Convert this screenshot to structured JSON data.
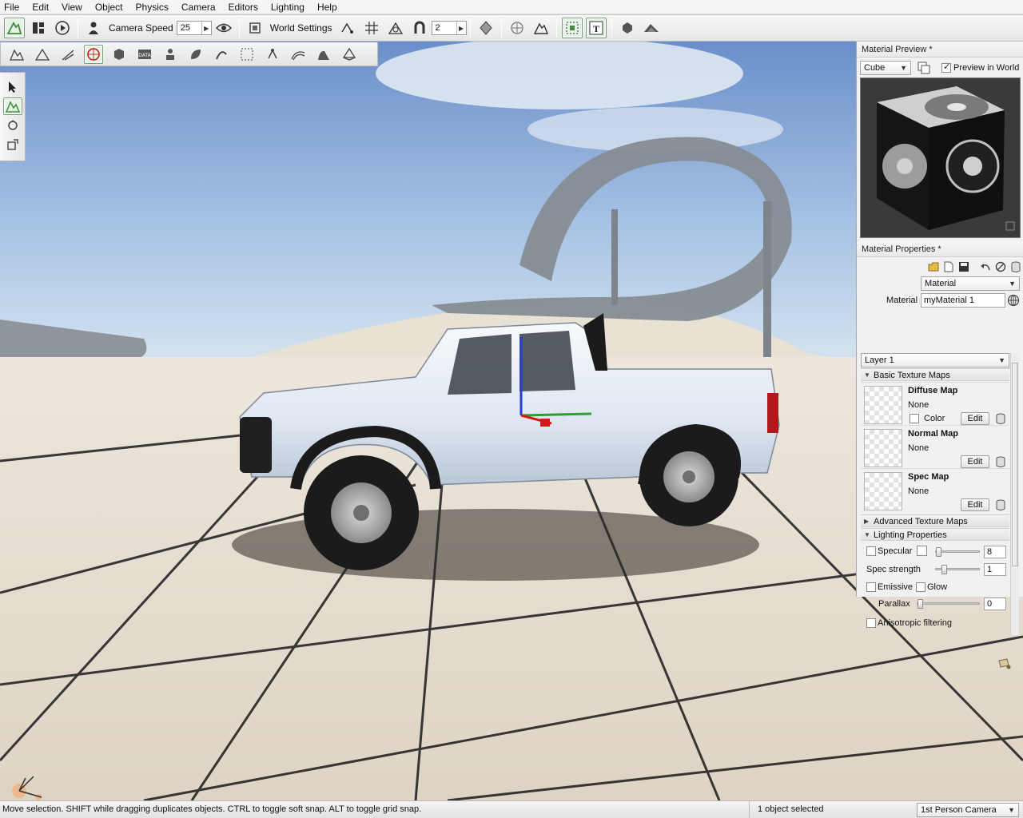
{
  "menu": [
    "File",
    "Edit",
    "View",
    "Object",
    "Physics",
    "Camera",
    "Editors",
    "Lighting",
    "Help"
  ],
  "toolbar": {
    "camera_speed_label": "Camera Speed",
    "camera_speed_value": "25",
    "world_settings_label": "World Settings",
    "snap_value": "2"
  },
  "material_preview": {
    "title": "Material Preview *",
    "shape": "Cube",
    "preview_in_world_label": "Preview in World",
    "preview_in_world_checked": true
  },
  "material_properties": {
    "title": "Material Properties *",
    "type_select": "Material",
    "material_label": "Material",
    "material_name": "myMaterial 1",
    "layer": "Layer 1",
    "basic_texture_maps": "Basic Texture Maps",
    "maps": [
      {
        "name": "Diffuse Map",
        "value": "None",
        "color_label": "Color",
        "edit": "Edit"
      },
      {
        "name": "Normal Map",
        "value": "None",
        "edit": "Edit"
      },
      {
        "name": "Spec Map",
        "value": "None",
        "edit": "Edit"
      }
    ],
    "advanced_texture_maps": "Advanced Texture Maps",
    "lighting_properties": "Lighting Properties",
    "specular_label": "Specular",
    "specular_value": "8",
    "spec_strength_label": "Spec strength",
    "spec_strength_value": "1",
    "emissive_label": "Emissive",
    "glow_label": "Glow",
    "parallax_label": "Parallax",
    "parallax_value": "0",
    "anisotropic_label": "Anisotropic filtering"
  },
  "status": {
    "message": "Move selection.  SHIFT while dragging duplicates objects.  CTRL to toggle soft snap.  ALT to toggle grid snap.",
    "selection": "1 object selected",
    "camera_mode": "1st Person Camera"
  },
  "colors": {
    "sky_top": "#6a8fc9",
    "sky_bottom": "#cfe0f0",
    "floor": "#e8e2d6",
    "truck_body": "#eef2f7",
    "accent_green": "#3c8c3c"
  }
}
